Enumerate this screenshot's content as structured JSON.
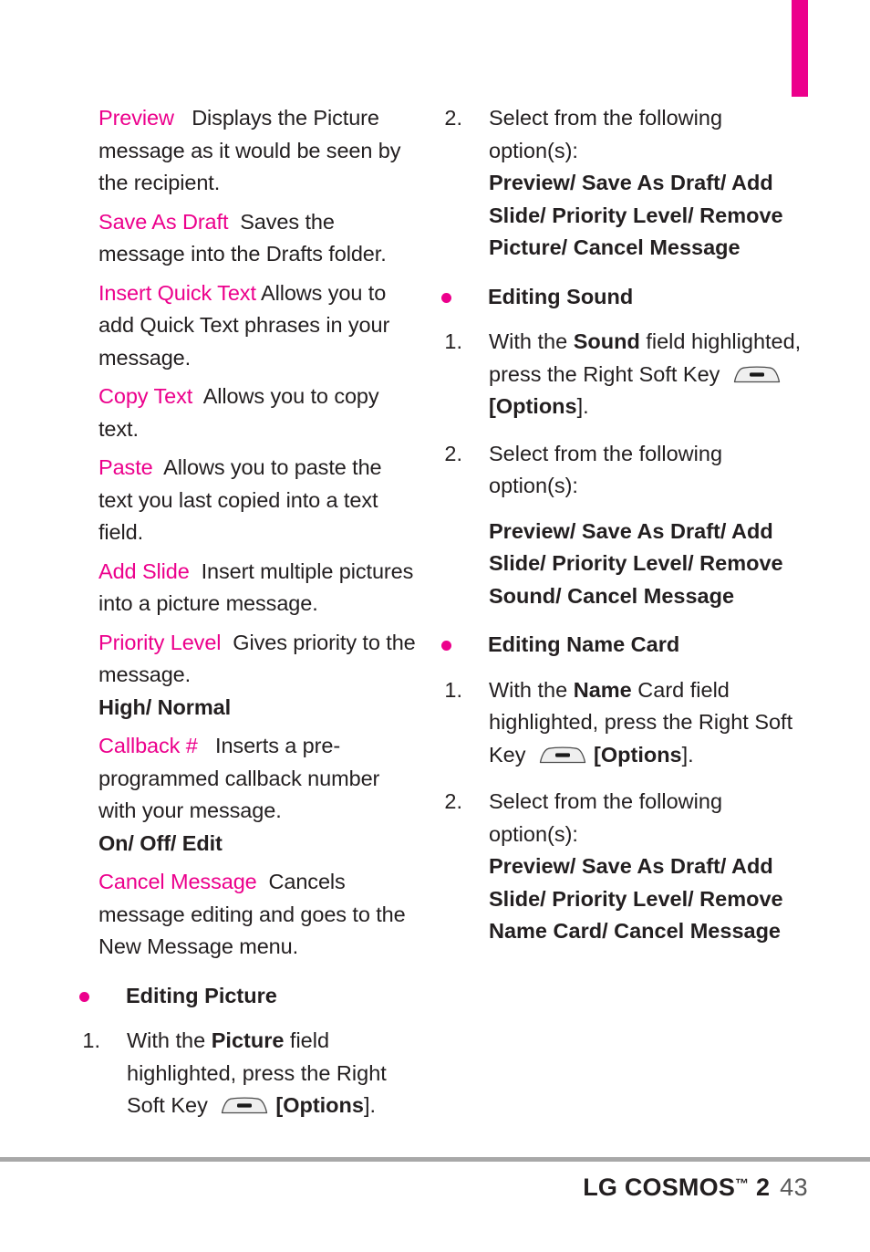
{
  "page": {
    "number": "43",
    "brand": "LG COSMOS",
    "brand_tm": "™",
    "brand_model": "2",
    "accent_color": "#ec008c",
    "text_color": "#231f20",
    "rule_color": "#a8a8a8"
  },
  "left_column": {
    "glossary": [
      {
        "term": "Preview",
        "description": "Displays the Picture message as it would be seen by the recipient."
      },
      {
        "term": "Save As Draft",
        "description": "Saves the message into the Drafts folder."
      },
      {
        "term": "Insert Quick Text",
        "description": "Allows you to add Quick Text phrases in your message."
      },
      {
        "term": "Copy Text",
        "description": "Allows you to copy text."
      },
      {
        "term": "Paste",
        "description": "Allows you to paste the text you last copied into a text field."
      },
      {
        "term": "Add Slide",
        "description": "Insert multiple pictures into a picture message."
      },
      {
        "term": "Priority Level",
        "description": "Gives priority to the message.",
        "options": "High/ Normal"
      },
      {
        "term": "Callback #",
        "description": "Inserts a pre-programmed callback number with your message.",
        "options": "On/ Off/ Edit"
      },
      {
        "term": "Cancel Message",
        "description": "Cancels message editing and goes to the New Message menu."
      }
    ],
    "section": {
      "heading": "Editing Picture",
      "steps": [
        {
          "number": "1.",
          "text_before": "With the ",
          "bold_word": "Picture",
          "text_after": " field highlighted, press the Right Soft Key",
          "key_icon": "soft-key-icon",
          "text_tail": "[",
          "key_label": "Options",
          "text_end": "]."
        }
      ]
    }
  },
  "right_column": {
    "picture_step2": {
      "number": "2.",
      "text": "Select from the following option(s):",
      "options": "Preview/ Save As Draft/ Add Slide/ Priority Level/ Remove Picture/ Cancel Message"
    },
    "sections": [
      {
        "heading": "Editing Sound",
        "step1": {
          "number": "1.",
          "text_before": "With the ",
          "bold_word": "Sound",
          "text_after": " field highlighted, press the Right Soft Key",
          "key_icon": "soft-key-icon",
          "text_tail": "[",
          "key_label": "Options",
          "text_end": "]."
        },
        "step2": {
          "number": "2.",
          "text": "Select from the following option(s):",
          "options": "Preview/ Save As Draft/ Add Slide/ Priority Level/ Remove Sound/ Cancel Message",
          "options_spaced": true
        }
      },
      {
        "heading": "Editing Name Card",
        "step1": {
          "number": "1.",
          "text_before": "With the ",
          "bold_word": "Name",
          "text_after": " Card field highlighted, press the Right Soft Key",
          "key_icon": "soft-key-icon",
          "text_tail": "[",
          "key_label": "Options",
          "text_end": "]."
        },
        "step2": {
          "number": "2.",
          "text": "Select from the following option(s):",
          "options": "Preview/ Save As Draft/ Add Slide/ Priority Level/ Remove Name Card/ Cancel Message",
          "options_spaced": false
        }
      }
    ]
  }
}
